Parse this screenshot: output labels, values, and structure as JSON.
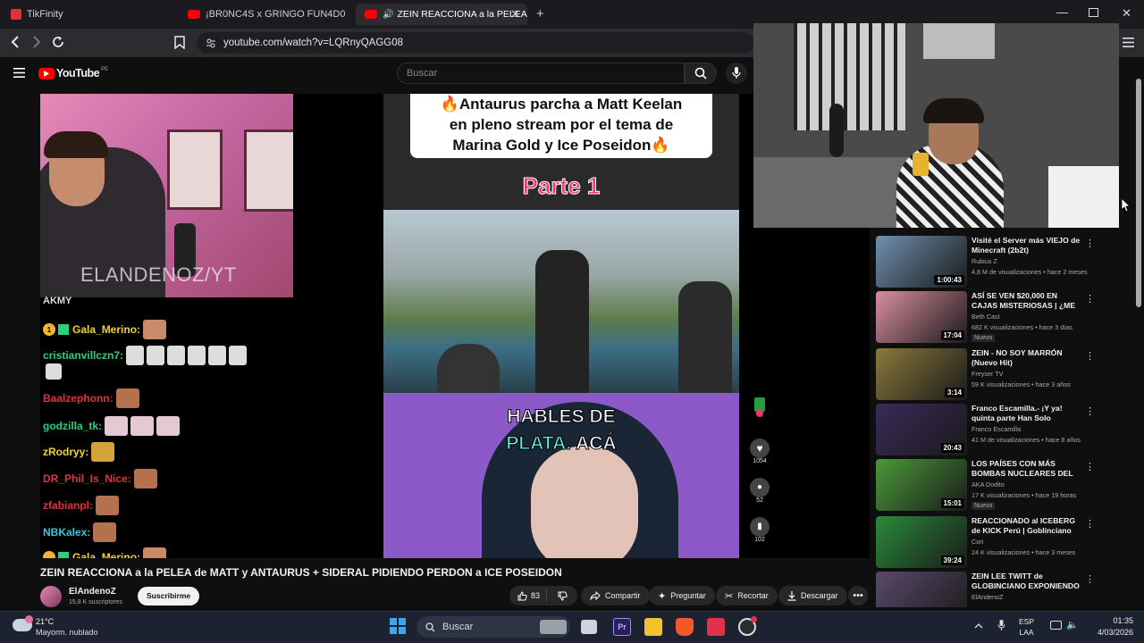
{
  "browser": {
    "tabs": [
      {
        "label": "TikFinity"
      },
      {
        "label": "¡BR0NC4S x GRINGO FUN4D0"
      },
      {
        "label": "ZEIN REACCIONA a la PELEA d"
      }
    ],
    "url": "youtube.com/watch?v=LQRnyQAGG08"
  },
  "youtube": {
    "logo": "YouTube",
    "region": "PE",
    "search_placeholder": "Buscar"
  },
  "video": {
    "overlay_watermark": "ELANDENOZ/YT",
    "chat_header": "AKMY",
    "chat": [
      {
        "user": "Gala_Merino:",
        "color": "#f3d531"
      },
      {
        "user": "cristianvillczn7:",
        "color": "#29d17c"
      },
      {
        "user": "Baalzephonn:",
        "color": "#e0323b"
      },
      {
        "user": "godzilla_tk:",
        "color": "#29d17c"
      },
      {
        "user": "zRodryy:",
        "color": "#f3d531"
      },
      {
        "user": "DR_Phil_Is_Nice:",
        "color": "#e0323b"
      },
      {
        "user": "zfabianpl:",
        "color": "#e0323b"
      },
      {
        "user": "NBKalex:",
        "color": "#39c7e0"
      },
      {
        "user": "Gala_Merino:",
        "color": "#f3d531"
      }
    ],
    "tiktok_caption_line1": "🔥Antaurus parcha a Matt Keelan",
    "tiktok_caption_line2": "en pleno stream por el tema de",
    "tiktok_caption_line3": "Marina Gold y Ice Poseidon🔥",
    "tiktok_part": "Parte 1",
    "tiktok_sub_line1": "HABLES DE",
    "tiktok_sub_line2a": "PLATA.",
    "tiktok_sub_line2b": "ACÁ",
    "tiktok_likes": "1054",
    "tiktok_comments": "52",
    "tiktok_saves": "102"
  },
  "watch": {
    "title": "ZEIN REACCIONA a la PELEA de MATT y ANTAURUS + SIDERAL PIDIENDO PERDON a ICE POSEIDON",
    "channel": "ElAndenoZ",
    "subscribers": "15,8 K suscriptores",
    "subscribe_label": "Suscribirme",
    "likes": "83",
    "share_label": "Compartir",
    "ask_label": "Preguntar",
    "clip_label": "Recortar",
    "download_label": "Descargar"
  },
  "recommendations": [
    {
      "title": "Visité el Server más VIEJO de Minecraft (2b2t)",
      "channel": "Rubius Z",
      "meta": "4,8 M de visualizaciones • hace 2 meses",
      "duration": "1:00:43",
      "badge": "",
      "thumb": "#6f8fb0"
    },
    {
      "title": "ASÍ SE VEN $20,000 EN CAJAS MISTERIOSAS | ¿ME ...",
      "channel": "Beth Cast",
      "meta": "682 K visualizaciones • hace 3 días",
      "duration": "17:04",
      "badge": "Nuevo",
      "thumb": "#d98fa0"
    },
    {
      "title": "ZEIN - NO SOY MARRÓN (Nuevo Hit)",
      "channel": "Freyser TV",
      "meta": "59 K visualizaciones • hace 3 años",
      "duration": "3:14",
      "badge": "",
      "thumb": "#8a7a3c"
    },
    {
      "title": "Franco Escamilla.- ¡Y ya! quinta parte Han Solo",
      "channel": "Franco Escamilla",
      "meta": "41 M de visualizaciones • hace 8 años",
      "duration": "20:43",
      "badge": "",
      "thumb": "#3a2a5a"
    },
    {
      "title": "LOS PAÍSES CON MÁS BOMBAS NUCLEARES DEL MUNDO ...",
      "channel": "AKA Dodito",
      "meta": "17 K visualizaciones • hace 19 horas",
      "duration": "15:01",
      "badge": "Nuevo",
      "thumb": "#4a9a3a"
    },
    {
      "title": "REACCIONADO al ICEBERG de KICK Perú | Goblinciano",
      "channel": "Cori",
      "meta": "24 K visualizaciones • hace 3 meses",
      "duration": "39:24",
      "badge": "",
      "thumb": "#2a8a3a"
    },
    {
      "title": "ZEIN LEE TWITT de GLOBINCIANO EXPONIENDO a...",
      "channel": "ElAndenoZ",
      "meta": "",
      "duration": "",
      "badge": "",
      "thumb": "#5a4a6a"
    }
  ],
  "taskbar": {
    "temperature": "21°C",
    "weather": "Mayorm. nublado",
    "search": "Buscar",
    "lang1": "ESP",
    "lang2": "LAA",
    "time": "01:35",
    "date": "4/03/2026"
  }
}
